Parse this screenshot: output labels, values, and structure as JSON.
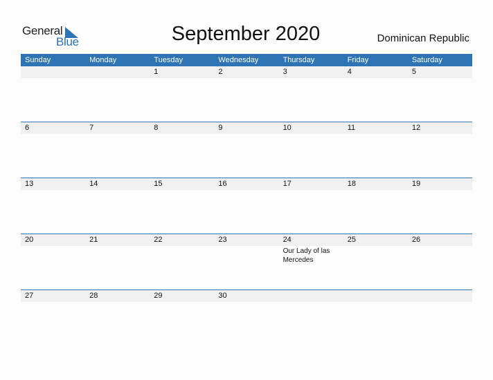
{
  "logo": {
    "word1": "General",
    "word2": "Blue",
    "icon": "triangle-flag-icon"
  },
  "title": "September 2020",
  "country": "Dominican Republic",
  "colors": {
    "accent": "#2E74B5",
    "band": "#F0F0F0"
  },
  "days_of_week": [
    "Sunday",
    "Monday",
    "Tuesday",
    "Wednesday",
    "Thursday",
    "Friday",
    "Saturday"
  ],
  "weeks": [
    [
      "",
      "",
      "1",
      "2",
      "3",
      "4",
      "5"
    ],
    [
      "6",
      "7",
      "8",
      "9",
      "10",
      "11",
      "12"
    ],
    [
      "13",
      "14",
      "15",
      "16",
      "17",
      "18",
      "19"
    ],
    [
      "20",
      "21",
      "22",
      "23",
      "24",
      "25",
      "26"
    ],
    [
      "27",
      "28",
      "29",
      "30",
      "",
      "",
      ""
    ]
  ],
  "holidays": [
    {
      "date": "24",
      "name": "Our Lady of las Mercedes"
    }
  ]
}
